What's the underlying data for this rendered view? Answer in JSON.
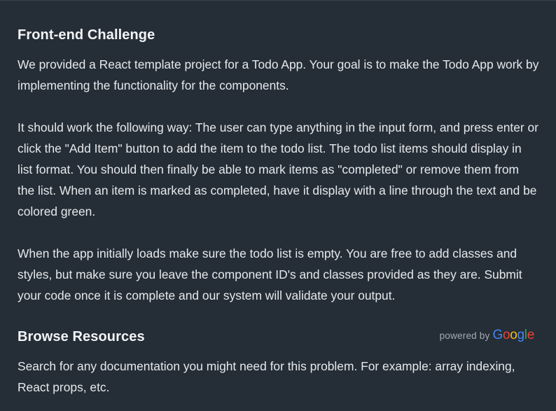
{
  "challenge": {
    "title": "Front-end Challenge",
    "paragraphs": [
      "We provided a React template project for a Todo App. Your goal is to make the Todo App work by implementing the functionality for the components.",
      "It should work the following way: The user can type anything in the input form, and press enter or click the \"Add Item\" button to add the item to the todo list. The todo list items should display in list format. You should then finally be able to mark items as \"completed\" or remove them from the list. When an item is marked as completed, have it display with a line through the text and be colored green.",
      "When the app initially loads make sure the todo list is empty. You are free to add classes and styles, but make sure you leave the component ID's and classes provided as they are. Submit your code once it is complete and our system will validate your output."
    ]
  },
  "resources": {
    "title": "Browse Resources",
    "powered_by": "powered by",
    "logo_letters": [
      "G",
      "o",
      "o",
      "g",
      "l",
      "e"
    ],
    "description": "Search for any documentation you might need for this problem. For example: array indexing, React props, etc."
  },
  "colors": {
    "background": "#252e37",
    "text": "#e6e9ec",
    "google_blue": "#4285f4",
    "google_red": "#ea4335",
    "google_yellow": "#fbbc05",
    "google_green": "#34a853"
  }
}
